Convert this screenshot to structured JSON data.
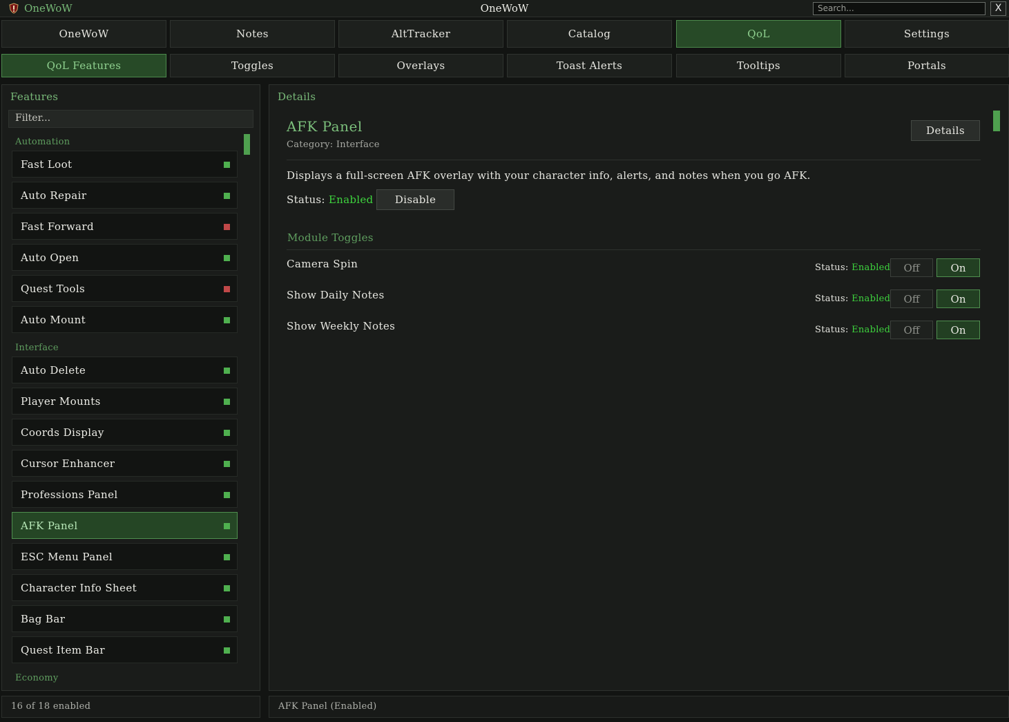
{
  "window": {
    "app_name": "OneWoW",
    "title": "OneWoW",
    "search_placeholder": "Search...",
    "close_label": "X"
  },
  "main_tabs": [
    {
      "label": "OneWoW",
      "active": false
    },
    {
      "label": "Notes",
      "active": false
    },
    {
      "label": "AltTracker",
      "active": false
    },
    {
      "label": "Catalog",
      "active": false
    },
    {
      "label": "QoL",
      "active": true
    },
    {
      "label": "Settings",
      "active": false
    }
  ],
  "sub_tabs": [
    {
      "label": "QoL Features",
      "active": true
    },
    {
      "label": "Toggles",
      "active": false
    },
    {
      "label": "Overlays",
      "active": false
    },
    {
      "label": "Toast Alerts",
      "active": false
    },
    {
      "label": "Tooltips",
      "active": false
    },
    {
      "label": "Portals",
      "active": false
    }
  ],
  "features_panel": {
    "title": "Features",
    "filter_placeholder": "Filter...",
    "categories": [
      {
        "name": "Automation",
        "items": [
          {
            "label": "Fast Loot",
            "enabled": true
          },
          {
            "label": "Auto Repair",
            "enabled": true
          },
          {
            "label": "Fast Forward",
            "enabled": false
          },
          {
            "label": "Auto Open",
            "enabled": true
          },
          {
            "label": "Quest Tools",
            "enabled": false
          },
          {
            "label": "Auto Mount",
            "enabled": true
          }
        ]
      },
      {
        "name": "Interface",
        "items": [
          {
            "label": "Auto Delete",
            "enabled": true
          },
          {
            "label": "Player Mounts",
            "enabled": true
          },
          {
            "label": "Coords Display",
            "enabled": true
          },
          {
            "label": "Cursor Enhancer",
            "enabled": true
          },
          {
            "label": "Professions Panel",
            "enabled": true
          },
          {
            "label": "AFK Panel",
            "enabled": true,
            "selected": true
          },
          {
            "label": "ESC Menu Panel",
            "enabled": true
          },
          {
            "label": "Character Info Sheet",
            "enabled": true
          },
          {
            "label": "Bag Bar",
            "enabled": true
          },
          {
            "label": "Quest Item Bar",
            "enabled": true
          }
        ]
      },
      {
        "name": "Economy",
        "items": []
      }
    ],
    "footer": "16 of 18 enabled"
  },
  "details_panel": {
    "title": "Details",
    "feature_name": "AFK Panel",
    "category": "Category: Interface",
    "details_button": "Details",
    "description": "Displays a full-screen AFK overlay with your character info, alerts, and notes when you go AFK.",
    "status_label": "Status:",
    "status_value": "Enabled",
    "disable_button": "Disable",
    "module_toggles_title": "Module Toggles",
    "toggles": [
      {
        "label": "Camera Spin",
        "status_label": "Status:",
        "status_value": "Enabled",
        "off": "Off",
        "on": "On"
      },
      {
        "label": "Show Daily Notes",
        "status_label": "Status:",
        "status_value": "Enabled",
        "off": "Off",
        "on": "On"
      },
      {
        "label": "Show Weekly Notes",
        "status_label": "Status:",
        "status_value": "Enabled",
        "off": "Off",
        "on": "On"
      }
    ],
    "footer": "AFK Panel (Enabled)"
  },
  "colors": {
    "accent": "#4fa04f",
    "enabled": "#3ed43e",
    "disabled": "#c04848",
    "background": "#121412"
  }
}
